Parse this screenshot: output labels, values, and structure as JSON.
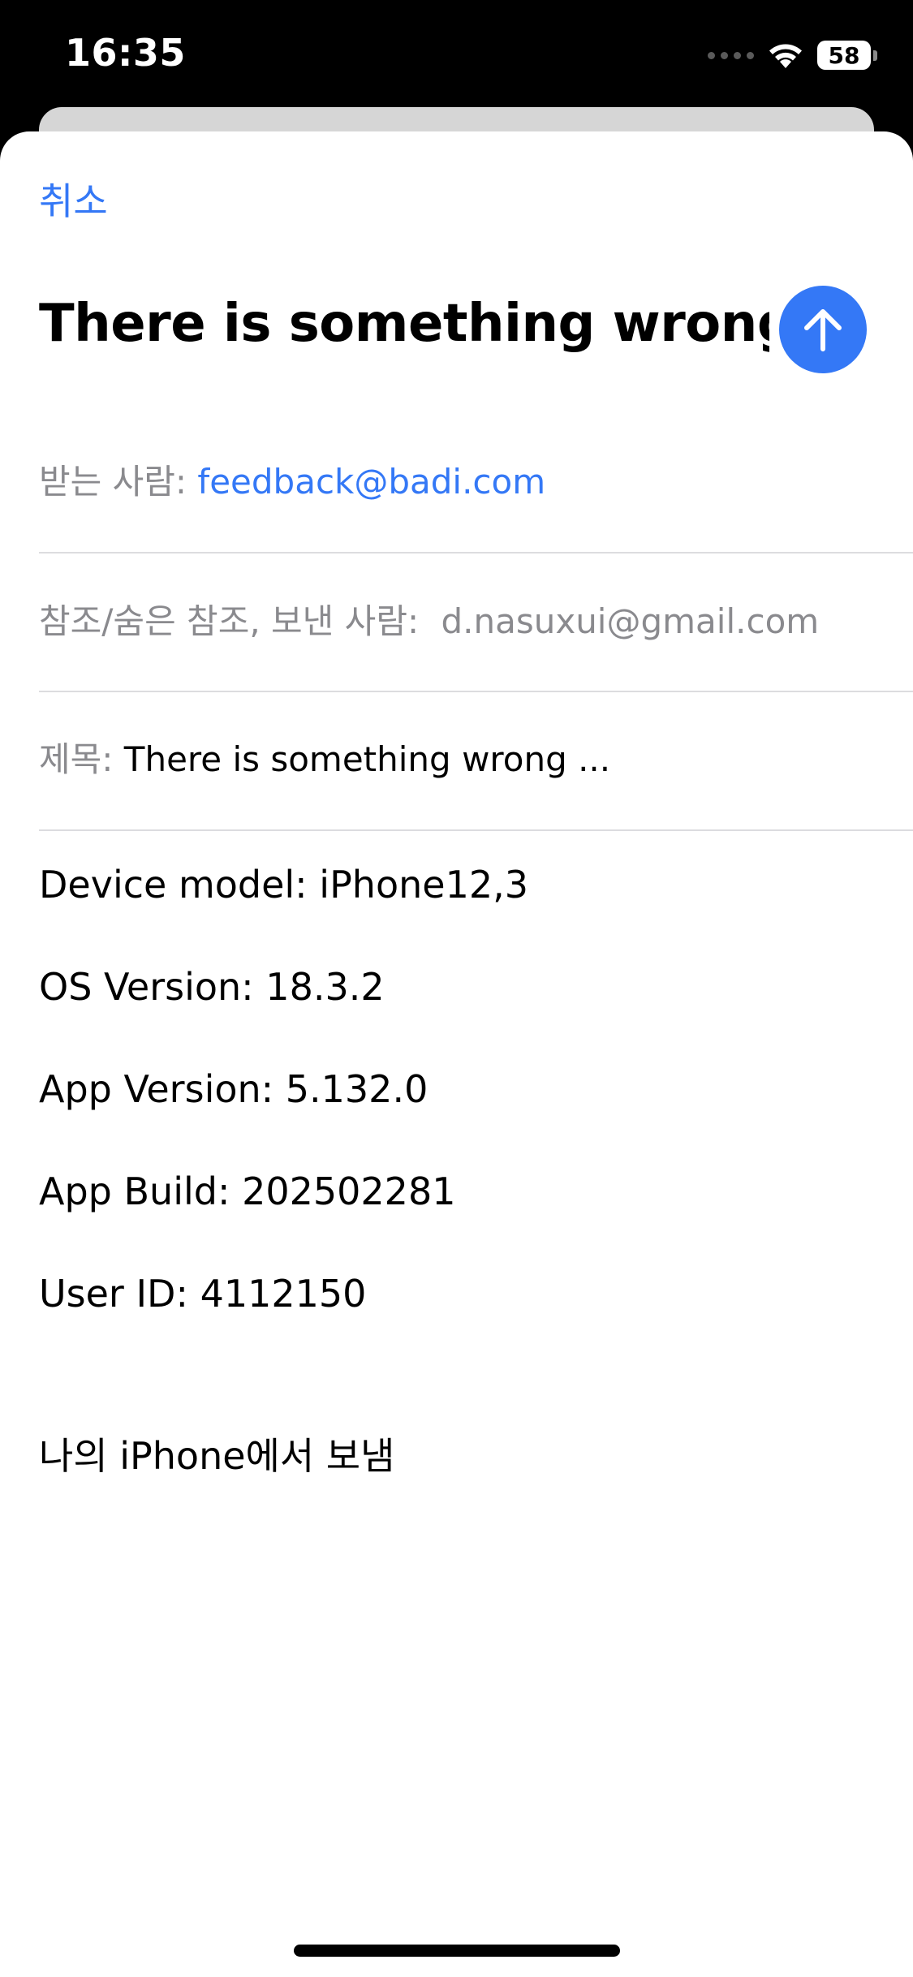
{
  "status_bar": {
    "time": "16:35",
    "battery": "58"
  },
  "compose": {
    "cancel_label": "취소",
    "title": "There is something wrong ...",
    "send_icon": "arrow-up-icon",
    "to_label": "받는 사람:",
    "to_value": "feedback@badi.com",
    "cc_label": "참조/숨은 참조, 보낸 사람:",
    "cc_value": "d.nasuxui@gmail.com",
    "subject_label": "제목:",
    "subject_value": "There is something wrong ..."
  },
  "body": {
    "lines": [
      "Device model: iPhone12,3",
      "OS Version: 18.3.2",
      "App Version: 5.132.0",
      "App Build: 202502281",
      "User ID: 4112150"
    ],
    "signature": "나의 iPhone에서 보냄"
  },
  "colors": {
    "accent": "#3478f6",
    "secondary_text": "#8a8a8e",
    "background": "#ffffff"
  }
}
